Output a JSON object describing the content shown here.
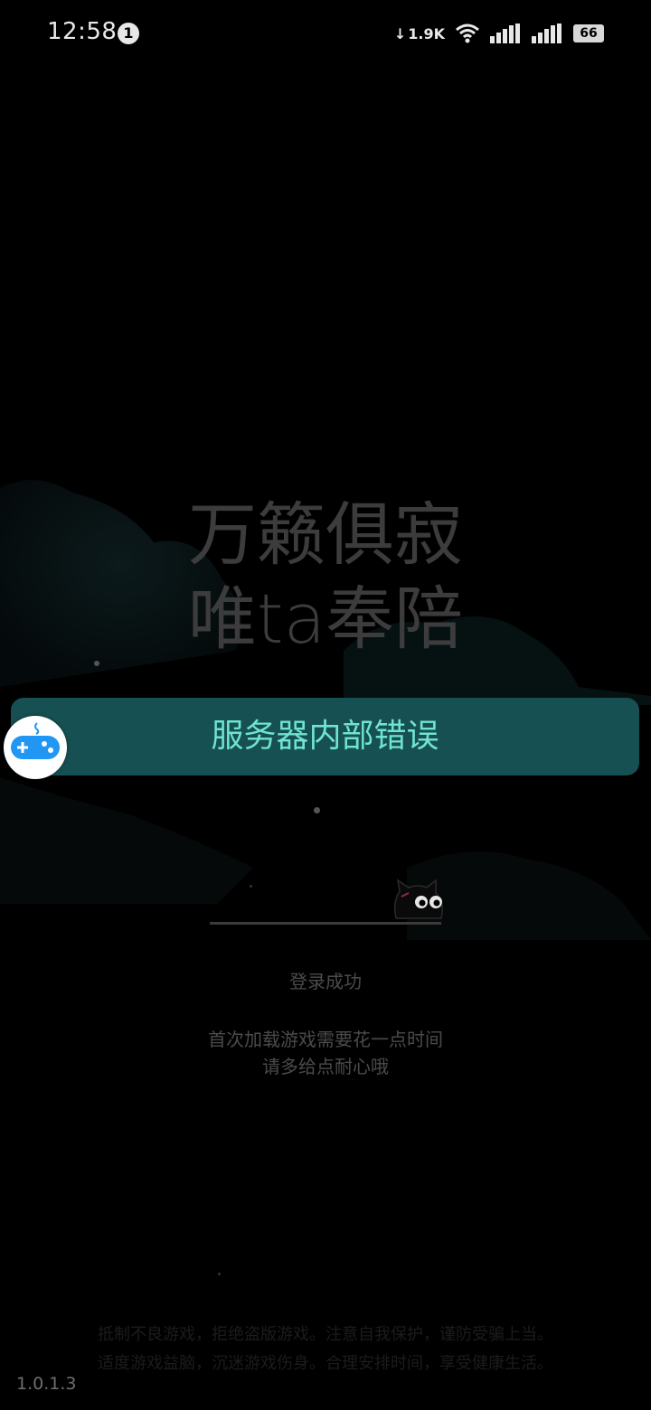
{
  "status_bar": {
    "time": "12:58",
    "notification_count": "1",
    "net_speed": "1.9K",
    "battery": "66"
  },
  "splash": {
    "slogan_line1": "万籁俱寂",
    "slogan_line2": "唯ta奉陪"
  },
  "toast": {
    "message": "服务器内部错误",
    "background": "#175052",
    "text_color": "#6fe4d0"
  },
  "floating_button": {
    "icon": "gamepad-icon",
    "color": "#2196f3"
  },
  "loading": {
    "status": "登录成功",
    "tip_line1": "首次加载游戏需要花一点时间",
    "tip_line2": "请多给点耐心哦"
  },
  "footer": {
    "advisory_line1": "抵制不良游戏，拒绝盗版游戏。注意自我保护，谨防受骗上当。",
    "advisory_line2": "适度游戏益脑，沉迷游戏伤身。合理安排时间，享受健康生活。",
    "version": "1.0.1.3"
  }
}
